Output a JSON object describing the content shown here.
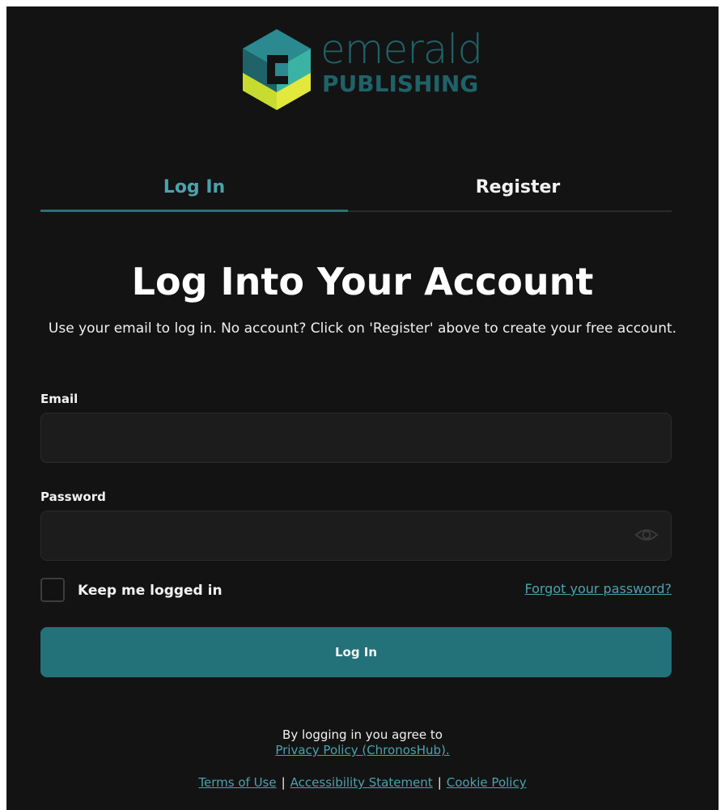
{
  "brand": {
    "word": "emerald",
    "sub": "PUBLISHING",
    "primary_color": "#1f6268",
    "accent_green": "#b7d432"
  },
  "tabs": [
    {
      "label": "Log In",
      "active": true
    },
    {
      "label": "Register",
      "active": false
    }
  ],
  "heading": "Log Into Your Account",
  "subtext": "Use your email to log in. No account? Click on 'Register' above to create your free account.",
  "form": {
    "email_label": "Email",
    "email_value": "",
    "password_label": "Password",
    "password_value": "",
    "keep_logged_in_label": "Keep me logged in",
    "keep_logged_in_checked": false,
    "forgot_password": "Forgot your password?",
    "submit_label": "Log In"
  },
  "legal": {
    "agree_text": "By logging in you agree to",
    "privacy_link": "Privacy Policy (ChronosHub).",
    "terms_link": "Terms of Use",
    "accessibility_link": "Accessibility Statement",
    "cookie_link": "Cookie Policy",
    "separator": "|"
  },
  "colors": {
    "background": "#131313",
    "accent": "#4aa3ad",
    "button": "#23727a"
  }
}
